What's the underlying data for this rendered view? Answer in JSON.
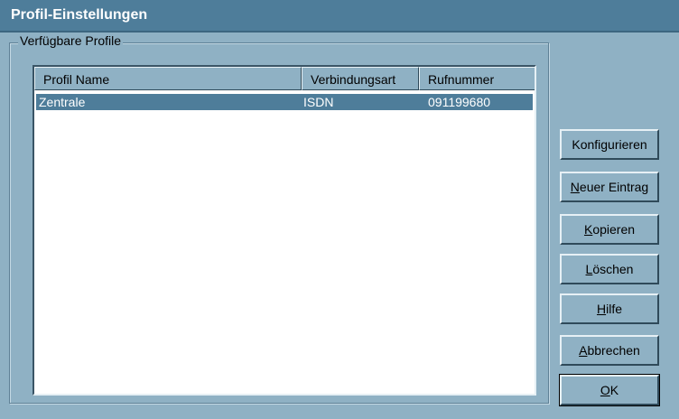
{
  "window": {
    "title": "Profil-Einstellungen"
  },
  "group": {
    "label": "Verfügbare Profile"
  },
  "list": {
    "columns": [
      "Profil Name",
      "Verbindungsart",
      "Rufnummer"
    ],
    "rows": [
      {
        "name": "Zentrale",
        "type": "ISDN",
        "number": "091199680",
        "selected": true
      }
    ]
  },
  "buttons": {
    "configure": {
      "pre": "Konfigurieren",
      "acc": "",
      "post": ""
    },
    "new_entry": {
      "pre": "",
      "acc": "N",
      "post": "euer Eintrag"
    },
    "copy": {
      "pre": "",
      "acc": "K",
      "post": "opieren"
    },
    "delete": {
      "pre": "",
      "acc": "L",
      "post": "öschen"
    },
    "help": {
      "pre": "",
      "acc": "H",
      "post": "ilfe"
    },
    "cancel": {
      "pre": "",
      "acc": "A",
      "post": "bbrechen"
    },
    "ok": {
      "pre": "",
      "acc": "O",
      "post": "K"
    }
  }
}
